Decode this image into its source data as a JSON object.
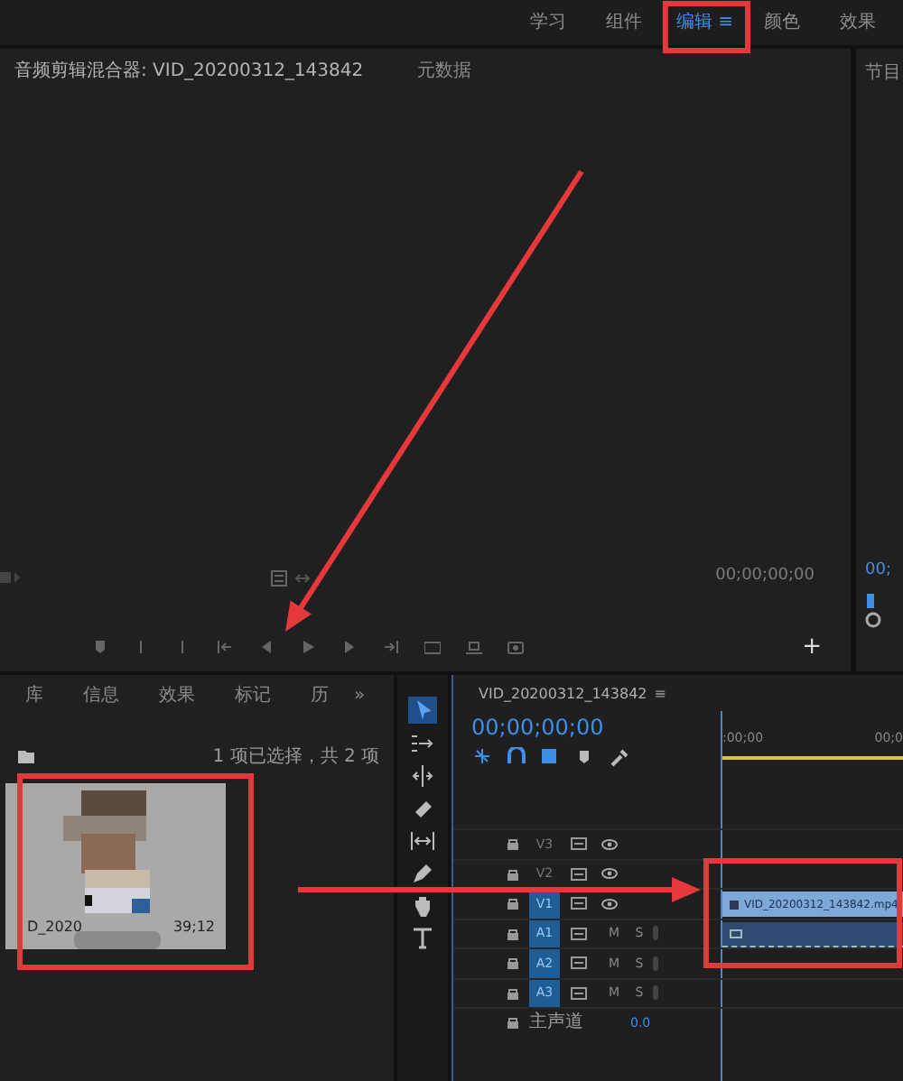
{
  "workspace": {
    "tabs": [
      {
        "label": "学习",
        "selected": false
      },
      {
        "label": "组件",
        "selected": false
      },
      {
        "label": "编辑",
        "selected": true
      },
      {
        "label": "颜色",
        "selected": false
      },
      {
        "label": "效果",
        "selected": false
      }
    ],
    "menu": "≡"
  },
  "source_panel": {
    "tabs": [
      {
        "label": "音频剪辑混合器: VID_20200312_143842",
        "selected": true
      },
      {
        "label": "元数据",
        "selected": false
      }
    ],
    "timecode": "00;00;00;00",
    "add": "+"
  },
  "program_panel": {
    "title": "节目",
    "timecode": "00;"
  },
  "project_panel": {
    "tabs": [
      {
        "label": "库"
      },
      {
        "label": "信息"
      },
      {
        "label": "效果"
      },
      {
        "label": "标记"
      },
      {
        "label": "历"
      }
    ],
    "overflow": "»",
    "selection_info": "1 项已选择，共 2 项",
    "item": {
      "kind": "picture",
      "name": "D_2020",
      "duration": "39;12"
    }
  },
  "tools": [
    {
      "kind": "selection",
      "selected": true
    },
    {
      "kind": "track-select",
      "selected": false
    },
    {
      "kind": "ripple",
      "selected": false
    },
    {
      "kind": "razor",
      "selected": false
    },
    {
      "kind": "slip",
      "selected": false
    },
    {
      "kind": "pen",
      "selected": false
    },
    {
      "kind": "hand",
      "selected": false
    },
    {
      "kind": "type",
      "selected": false
    }
  ],
  "timeline": {
    "title": "VID_20200312_143842",
    "menu": "≡",
    "timecode": "00;00;00;00",
    "ruler": [
      ":00;00",
      "00;0"
    ],
    "tracks": [
      {
        "label": "V3",
        "kind": "video",
        "targeted": false
      },
      {
        "label": "V2",
        "kind": "video",
        "targeted": false
      },
      {
        "label": "V1",
        "kind": "video",
        "targeted": true,
        "clip": "VID_20200312_143842.mp4"
      },
      {
        "label": "A1",
        "kind": "audio",
        "targeted": true,
        "mute": "M",
        "solo": "S",
        "audio_clip": true
      },
      {
        "label": "A2",
        "kind": "audio",
        "targeted": true,
        "mute": "M",
        "solo": "S"
      },
      {
        "label": "A3",
        "kind": "audio",
        "targeted": true,
        "mute": "M",
        "solo": "S"
      }
    ],
    "master": {
      "label": "主声道",
      "value": "0.0"
    }
  }
}
